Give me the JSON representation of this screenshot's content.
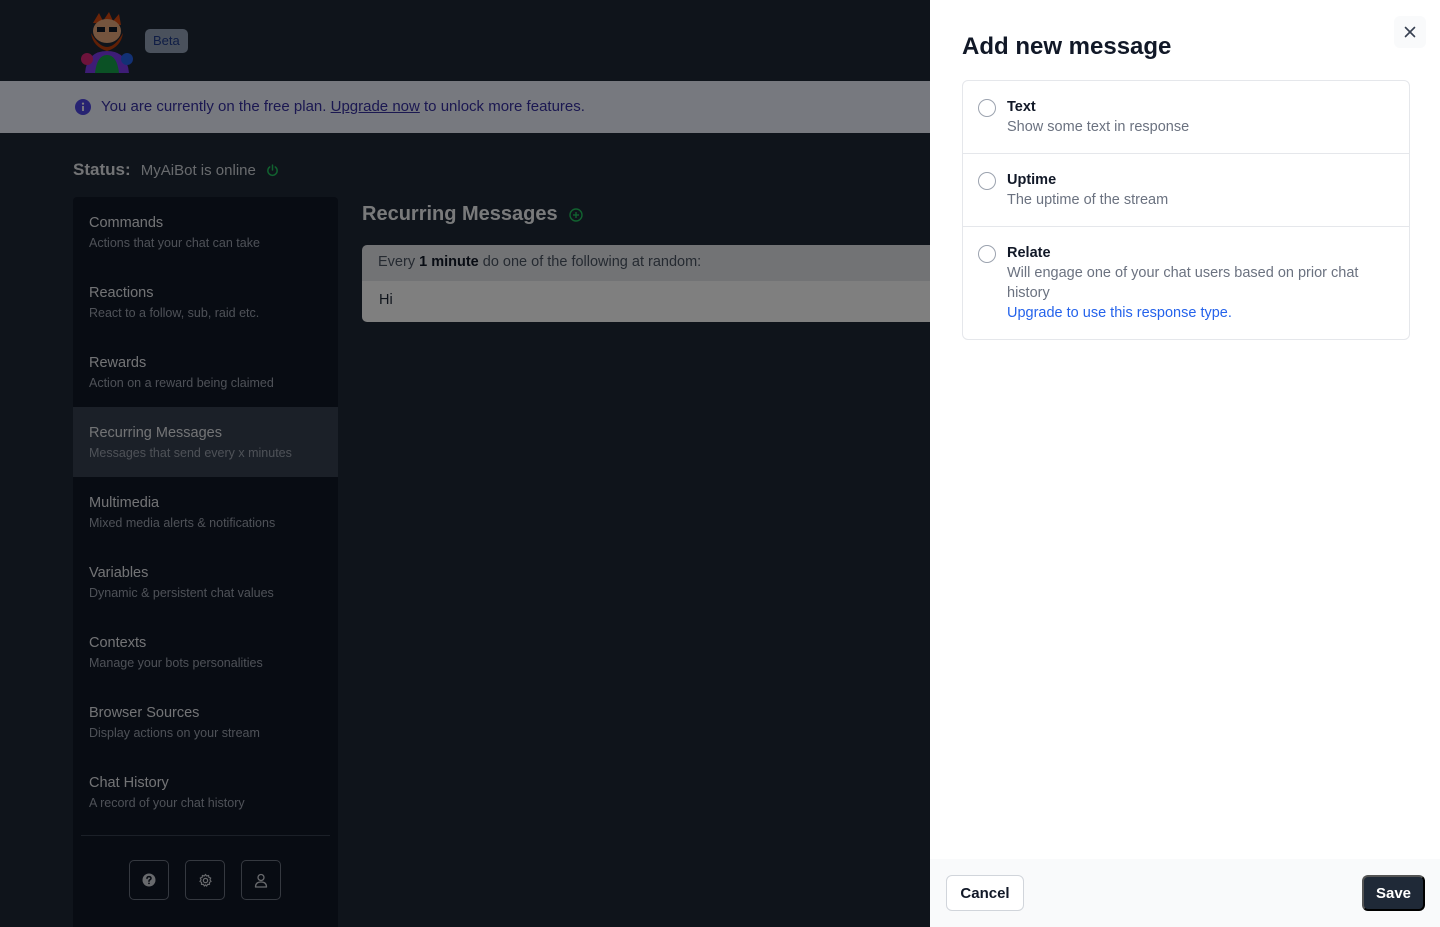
{
  "header": {
    "logo_icon": "bearded-avatar-logo",
    "beta_badge": "Beta"
  },
  "banner": {
    "text_before": "You are currently on the free plan.",
    "link": "Upgrade now",
    "text_after": "to unlock more features."
  },
  "status": {
    "label": "Status:",
    "text": "MyAiBot is online",
    "indicator_color": "#22c55e"
  },
  "sidebar": {
    "items": [
      {
        "title": "Commands",
        "subtitle": "Actions that your chat can take"
      },
      {
        "title": "Reactions",
        "subtitle": "React to a follow, sub, raid etc."
      },
      {
        "title": "Rewards",
        "subtitle": "Action on a reward being claimed"
      },
      {
        "title": "Recurring Messages",
        "subtitle": "Messages that send every x minutes"
      },
      {
        "title": "Multimedia",
        "subtitle": "Mixed media alerts & notifications"
      },
      {
        "title": "Variables",
        "subtitle": "Dynamic & persistent chat values"
      },
      {
        "title": "Contexts",
        "subtitle": "Manage your bots personalities"
      },
      {
        "title": "Browser Sources",
        "subtitle": "Display actions on your stream"
      },
      {
        "title": "Chat History",
        "subtitle": "A record of your chat history"
      }
    ],
    "active_item": "Recurring Messages",
    "footer_buttons": [
      "help-icon",
      "gear-icon",
      "user-icon"
    ]
  },
  "main": {
    "title": "Recurring Messages",
    "schedule": {
      "prefix": "Every",
      "interval": "1 minute",
      "suffix": "do one of the following at random:"
    },
    "messages": [
      "Hi"
    ]
  },
  "drawer": {
    "title": "Add new message",
    "options": [
      {
        "title": "Text",
        "description": "Show some text in response",
        "selected": false
      },
      {
        "title": "Uptime",
        "description": "The uptime of the stream",
        "selected": false
      },
      {
        "title": "Relate",
        "description": "Will engage one of your chat users based on prior chat history",
        "link": "Upgrade to use this response type.",
        "selected": false
      }
    ],
    "cancel_label": "Cancel",
    "save_label": "Save"
  }
}
